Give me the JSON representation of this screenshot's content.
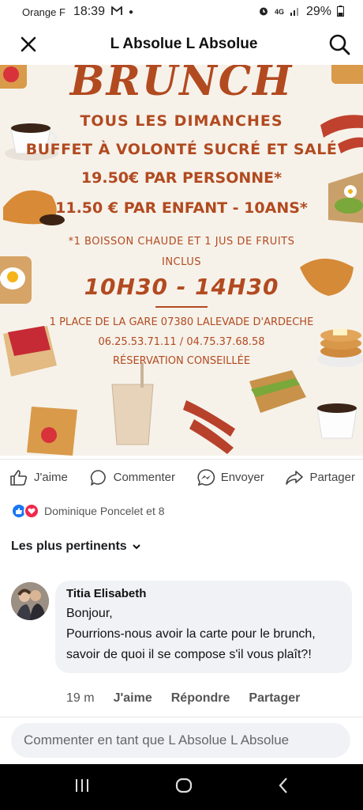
{
  "status": {
    "carrier": "Orange F",
    "time": "18:39",
    "network": "4G",
    "battery": "29%"
  },
  "header": {
    "title": "L Absolue L Absolue"
  },
  "poster": {
    "headline": "BRUNCH",
    "line1": "TOUS LES DIMANCHES",
    "line2": "BUFFET À VOLONTÉ SUCRÉ ET SALÉ",
    "line3": "19.50€ PAR PERSONNE*",
    "line4": "11.50 € PAR ENFANT - 10ANS*",
    "line5": "*1 BOISSON CHAUDE ET 1 JUS DE FRUITS",
    "line6": "INCLUS",
    "hours": "10H30 - 14H30",
    "address": "1 PLACE DE LA GARE 07380 LALEVADE D'ARDECHE",
    "phones": "06.25.53.71.11 / 04.75.37.68.58",
    "reservation": "RÉSERVATION CONSEILLÉE",
    "accent_color": "#b24a20"
  },
  "actions": {
    "like": "J'aime",
    "comment": "Commenter",
    "send": "Envoyer",
    "share": "Partager"
  },
  "reactions": {
    "summary": "Dominique Poncelet et 8"
  },
  "comments_sort": {
    "label": "Les plus pertinents"
  },
  "comment": {
    "author": "Titia Elisabeth",
    "text": "Bonjour,\nPourrions-nous avoir la carte pour le brunch, savoir de quoi il se compose s'il vous plaît?!",
    "time": "19 m",
    "like": "J'aime",
    "reply": "Répondre",
    "share": "Partager"
  },
  "composer": {
    "placeholder": "Commenter en tant que L Absolue L Absolue"
  }
}
